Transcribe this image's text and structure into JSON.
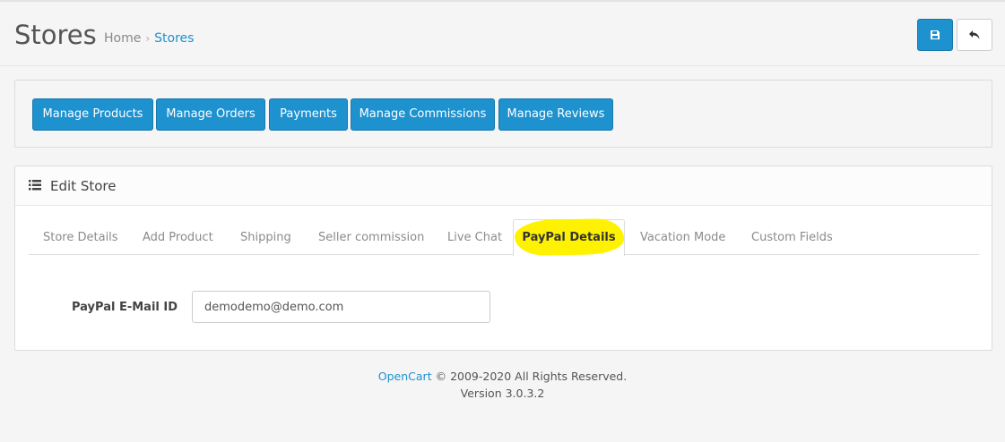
{
  "header": {
    "title": "Stores",
    "breadcrumb": [
      {
        "label": "Home"
      },
      {
        "label": "Stores"
      }
    ],
    "breadcrumb_separator": "›",
    "save_icon": "floppy-disk-icon",
    "back_icon": "reply-arrow-icon"
  },
  "nav_buttons": [
    {
      "label": "Manage Products"
    },
    {
      "label": "Manage Orders"
    },
    {
      "label": "Payments"
    },
    {
      "label": "Manage Commissions"
    },
    {
      "label": "Manage Reviews"
    }
  ],
  "edit_panel": {
    "icon": "list-icon",
    "title": "Edit Store",
    "tabs": [
      {
        "label": "Store Details"
      },
      {
        "label": "Add Product"
      },
      {
        "label": "Shipping"
      },
      {
        "label": "Seller commission"
      },
      {
        "label": "Live Chat"
      },
      {
        "label": "PayPal Details",
        "active": true
      },
      {
        "label": "Vacation Mode"
      },
      {
        "label": "Custom Fields"
      }
    ],
    "field": {
      "label": "PayPal E-Mail ID",
      "value": "demodemo@demo.com"
    }
  },
  "footer": {
    "link": "OpenCart",
    "copyright": "© 2009-2020 All Rights Reserved.",
    "version": "Version 3.0.3.2"
  },
  "colors": {
    "primary": "#1e91cf",
    "highlight": "#fff200",
    "background": "#f5f5f5"
  }
}
